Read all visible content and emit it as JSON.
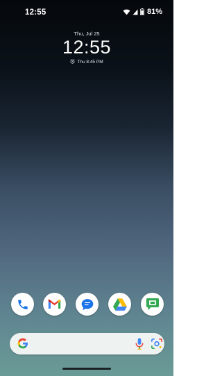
{
  "status_bar": {
    "time": "12:55",
    "battery_percent": "81%",
    "icons": [
      "wifi-icon",
      "signal-icon",
      "battery-icon"
    ]
  },
  "lock_clock": {
    "date": "Thu, Jul 25",
    "time": "12:55",
    "alarm": "Thu 8:45 PM",
    "alarm_icon": "alarm-icon"
  },
  "dock": {
    "apps": [
      {
        "name": "Phone",
        "icon": "phone-icon"
      },
      {
        "name": "Gmail",
        "icon": "gmail-icon"
      },
      {
        "name": "Messages",
        "icon": "messages-icon"
      },
      {
        "name": "Drive",
        "icon": "drive-icon"
      },
      {
        "name": "Chat",
        "icon": "chat-icon"
      }
    ]
  },
  "search_bar": {
    "icons": [
      "google-g-icon",
      "microphone-icon",
      "google-lens-icon"
    ]
  },
  "colors": {
    "google_blue": "#4285F4",
    "google_red": "#EA4335",
    "google_yellow": "#FBBC04",
    "google_green": "#34A853",
    "phone_blue": "#1a73e8"
  }
}
